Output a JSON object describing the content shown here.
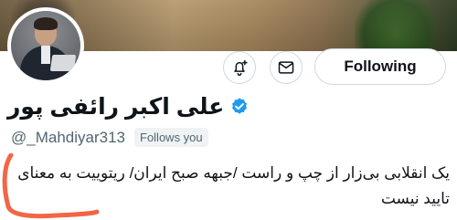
{
  "profile": {
    "display_name": "علی اکبر رائفی پور",
    "handle": "@_Mahdiyar313",
    "follows_you": "Follows you",
    "bio_line1": "یک انقلابی بی‌زار از چپ و راست /جبهه صبح ایران/ ریتوییت به معنای",
    "bio_line2": "تایید نیست"
  },
  "actions": {
    "following_label": "Following"
  },
  "colors": {
    "verified": "#1d9bf0",
    "annotation": "#f04a24",
    "border": "#cfd9de"
  },
  "icons": {
    "notify": "bell-plus-icon",
    "message": "envelope-icon",
    "verified": "verified-badge-icon"
  }
}
